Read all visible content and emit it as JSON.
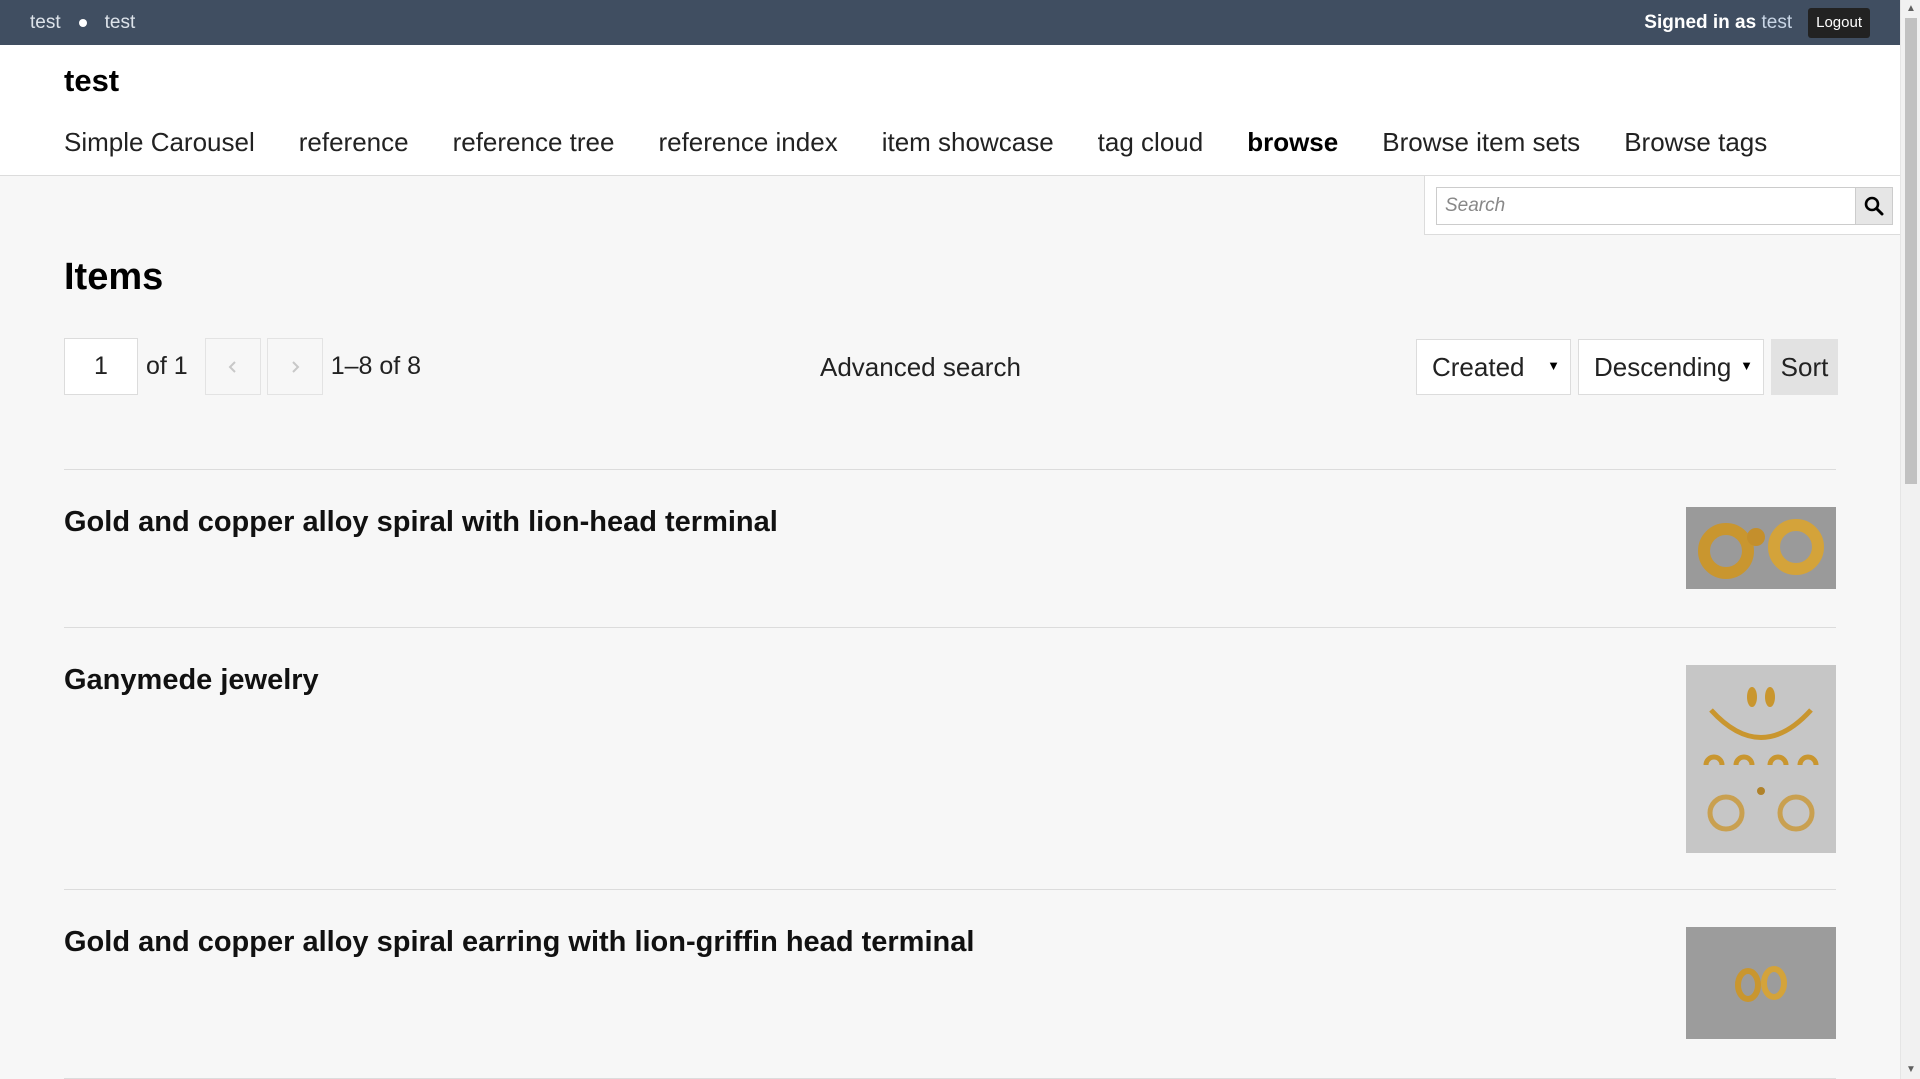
{
  "admin_bar": {
    "site_link_1": "test",
    "site_link_2": "test",
    "signed_in_prefix": "Signed in as",
    "user_name": "test",
    "logout_label": "Logout"
  },
  "header": {
    "site_title": "test",
    "nav": [
      {
        "label": "Simple Carousel",
        "active": false
      },
      {
        "label": "reference",
        "active": false
      },
      {
        "label": "reference tree",
        "active": false
      },
      {
        "label": "reference index",
        "active": false
      },
      {
        "label": "item showcase",
        "active": false
      },
      {
        "label": "tag cloud",
        "active": false
      },
      {
        "label": "browse",
        "active": true
      },
      {
        "label": "Browse item sets",
        "active": false
      },
      {
        "label": "Browse tags",
        "active": false
      }
    ]
  },
  "search": {
    "placeholder": "Search",
    "button_icon": "search-icon"
  },
  "main": {
    "heading": "Items",
    "pagination": {
      "current_page": "1",
      "of_text": "of 1",
      "prev_icon": "chevron-left-icon",
      "next_icon": "chevron-right-icon",
      "range_text": "1–8 of 8"
    },
    "advanced_search_label": "Advanced search",
    "sort": {
      "sort_by_value": "Created",
      "order_value": "Descending",
      "sort_button_label": "Sort"
    },
    "items": [
      {
        "title": "Gold and copper alloy spiral with lion-head terminal"
      },
      {
        "title": "Ganymede jewelry"
      },
      {
        "title": "Gold and copper alloy spiral earring with lion-griffin head terminal"
      }
    ]
  },
  "colors": {
    "admin_bar_bg": "#404e61",
    "page_bg": "#f7f7f7",
    "header_bg": "#ffffff"
  }
}
